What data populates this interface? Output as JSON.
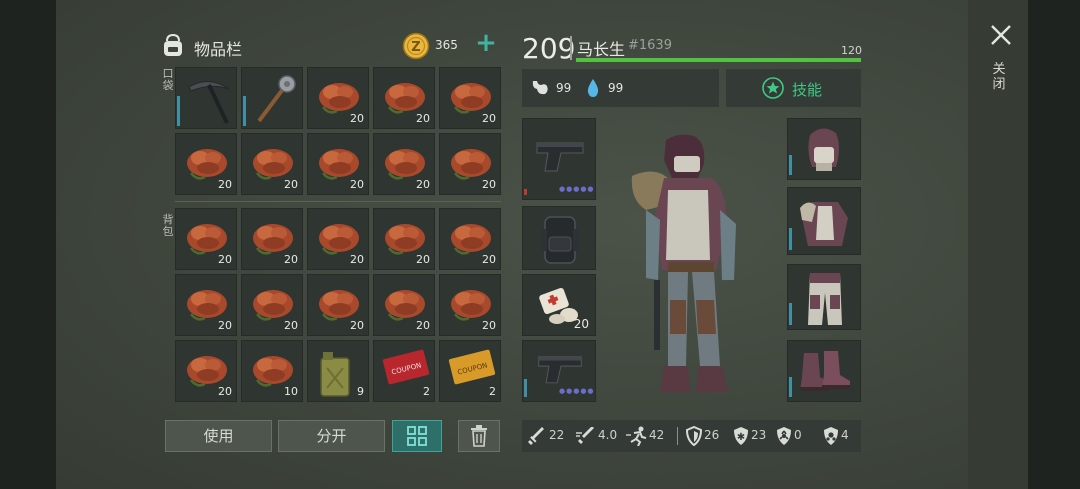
{
  "inventory": {
    "title": "物品栏",
    "coins": "365",
    "add_label": "+",
    "pocket_label": "口袋",
    "backpack_label": "背包",
    "pocket_slots": [
      {
        "item": "pickaxe",
        "qty": ""
      },
      {
        "item": "mace",
        "qty": ""
      },
      {
        "item": "meat",
        "qty": "20"
      },
      {
        "item": "meat",
        "qty": "20"
      },
      {
        "item": "meat",
        "qty": "20"
      },
      {
        "item": "meat",
        "qty": "20"
      },
      {
        "item": "meat",
        "qty": "20"
      },
      {
        "item": "meat",
        "qty": "20"
      },
      {
        "item": "meat",
        "qty": "20"
      },
      {
        "item": "meat",
        "qty": "20"
      }
    ],
    "backpack_slots": [
      {
        "item": "meat",
        "qty": "20"
      },
      {
        "item": "meat",
        "qty": "20"
      },
      {
        "item": "meat",
        "qty": "20"
      },
      {
        "item": "meat",
        "qty": "20"
      },
      {
        "item": "meat",
        "qty": "20"
      },
      {
        "item": "meat",
        "qty": "20"
      },
      {
        "item": "meat",
        "qty": "20"
      },
      {
        "item": "meat",
        "qty": "20"
      },
      {
        "item": "meat",
        "qty": "20"
      },
      {
        "item": "meat",
        "qty": "20"
      },
      {
        "item": "meat",
        "qty": "20"
      },
      {
        "item": "meat",
        "qty": "10"
      },
      {
        "item": "fuel-can",
        "qty": "9"
      },
      {
        "item": "red-coupon",
        "qty": "2"
      },
      {
        "item": "gold-coupon",
        "qty": "2"
      }
    ]
  },
  "actions": {
    "use_label": "使用",
    "split_label": "分开"
  },
  "player": {
    "level": "209",
    "name": "马长生",
    "id": "#1639",
    "hp": "120",
    "hunger": "99",
    "thirst": "99",
    "skills_label": "技能"
  },
  "equipment": {
    "pistol_top": {
      "item": "pistol"
    },
    "backpack": {
      "item": "backpack"
    },
    "medkit": {
      "item": "bandage",
      "qty": "20"
    },
    "pistol_bottom": {
      "item": "pistol"
    },
    "helmet": {
      "item": "hood"
    },
    "armor": {
      "item": "chest-armor"
    },
    "pants": {
      "item": "pants"
    },
    "boots": {
      "item": "boots"
    }
  },
  "stats": {
    "attack": "22",
    "attack_speed": "4.0",
    "speed": "42",
    "defense": "26",
    "cold": "23",
    "radiation": "0",
    "toxic": "4"
  },
  "close_label": "关闭",
  "colors": {
    "accent": "#3fb4a0",
    "hp": "#53c240",
    "skill": "#3fca84"
  }
}
